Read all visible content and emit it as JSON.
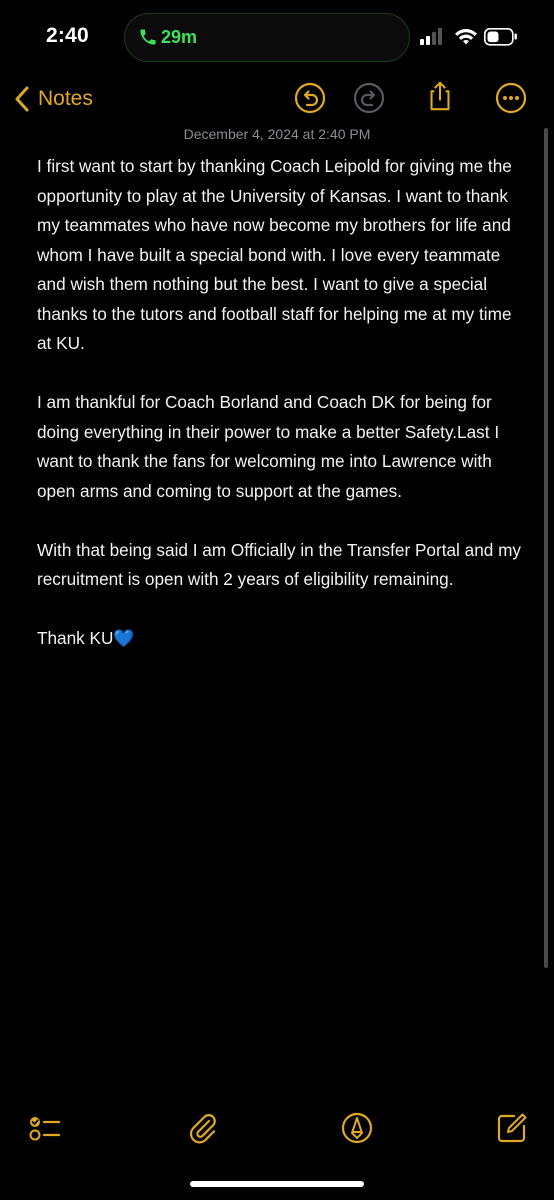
{
  "status_bar": {
    "time": "2:40",
    "call_duration": "29m",
    "signal_icon": "cellular-signal-icon",
    "wifi_icon": "wifi-icon",
    "battery_icon": "battery-icon"
  },
  "nav": {
    "back_label": "Notes",
    "undo_icon": "undo-icon",
    "redo_icon": "redo-icon",
    "share_icon": "share-icon",
    "more_icon": "more-icon"
  },
  "note": {
    "date": "December 4, 2024 at 2:40 PM",
    "paragraphs": [
      "I first want to start by thanking Coach Leipold for giving me the opportunity to play at the University of Kansas. I want to thank my teammates who have now become my brothers for life and whom I have built a special bond with. I love every teammate and wish them nothing but the best. I want to give a special thanks to the tutors and football staff for helping me at my time at KU.",
      "I am thankful for Coach Borland and Coach DK for being for doing everything in their power to make a better Safety.Last I want to thank the fans for welcoming me into Lawrence with open arms and coming to support at the games.",
      "With that being said I am Officially in the Transfer Portal and my recruitment is open with 2 years of eligibility remaining."
    ],
    "closing": "Thank KU",
    "closing_emoji": "💙"
  },
  "toolbar": {
    "checklist_icon": "checklist-icon",
    "attachment_icon": "paperclip-icon",
    "markup_icon": "markup-pen-icon",
    "compose_icon": "compose-icon"
  },
  "colors": {
    "accent": "#e0a823",
    "call_green": "#3ee25a",
    "background": "#000000",
    "text": "#f2f2f2",
    "date_gray": "#8d8d92",
    "heart_blue": "#1e63e6"
  }
}
